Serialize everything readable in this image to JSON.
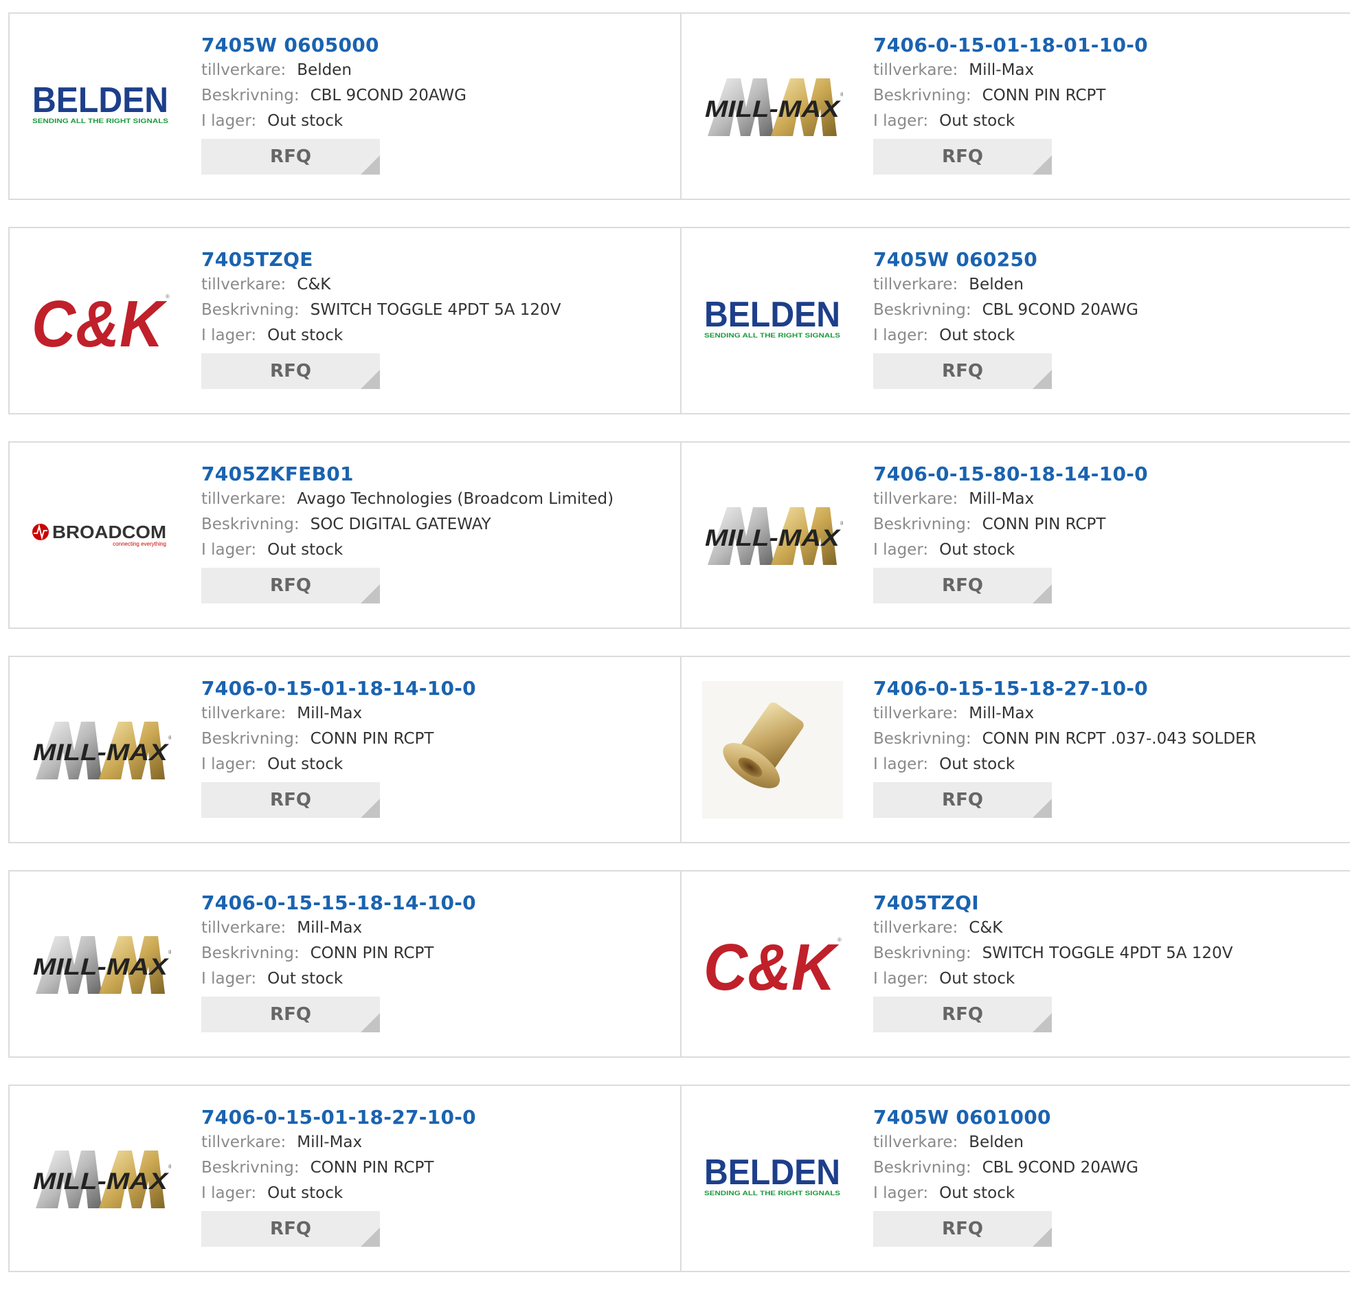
{
  "labels": {
    "manufacturer": "tillverkare:",
    "description": "Beskrivning:",
    "stock": "I lager:",
    "rfq": "RFQ"
  },
  "brand_logos": {
    "belden": {
      "name": "BELDEN",
      "tagline": "SENDING ALL THE RIGHT SIGNALS",
      "color": "#1d3f8a",
      "tagline_color": "#1a9a3c"
    },
    "millmax": {
      "name": "MILL-MAX",
      "color": "#222222",
      "gold": "#c9a44a",
      "silver": "#b5b5b5"
    },
    "ck": {
      "name": "C&K",
      "color": "#c0202a"
    },
    "broadcom": {
      "name": "BROADCOM",
      "tagline": "connecting everything",
      "color": "#cc0000"
    }
  },
  "colors": {
    "link": "#1a63b0",
    "label": "#8a8a8a",
    "button_bg": "#ececec",
    "border": "#dcdcdc"
  },
  "rows": [
    [
      {
        "part": "7405W 0605000",
        "manufacturer": "Belden",
        "description": "CBL 9COND 20AWG",
        "stock": "Out stock",
        "logo": "belden"
      },
      {
        "part": "7406-0-15-01-18-01-10-0",
        "manufacturer": "Mill-Max",
        "description": "CONN PIN RCPT",
        "stock": "Out stock",
        "logo": "millmax"
      }
    ],
    [
      {
        "part": "7405TZQE",
        "manufacturer": "C&K",
        "description": "SWITCH TOGGLE 4PDT 5A 120V",
        "stock": "Out stock",
        "logo": "ck"
      },
      {
        "part": "7405W 060250",
        "manufacturer": "Belden",
        "description": "CBL 9COND 20AWG",
        "stock": "Out stock",
        "logo": "belden"
      }
    ],
    [
      {
        "part": "7405ZKFEB01",
        "manufacturer": "Avago Technologies (Broadcom Limited)",
        "description": "SOC DIGITAL GATEWAY",
        "stock": "Out stock",
        "logo": "broadcom"
      },
      {
        "part": "7406-0-15-80-18-14-10-0",
        "manufacturer": "Mill-Max",
        "description": "CONN PIN RCPT",
        "stock": "Out stock",
        "logo": "millmax"
      }
    ],
    [
      {
        "part": "7406-0-15-01-18-14-10-0",
        "manufacturer": "Mill-Max",
        "description": "CONN PIN RCPT",
        "stock": "Out stock",
        "logo": "millmax"
      },
      {
        "part": "7406-0-15-15-18-27-10-0",
        "manufacturer": "Mill-Max",
        "description": "CONN PIN RCPT .037-.043 SOLDER",
        "stock": "Out stock",
        "logo": "pin-photo"
      }
    ],
    [
      {
        "part": "7406-0-15-15-18-14-10-0",
        "manufacturer": "Mill-Max",
        "description": "CONN PIN RCPT",
        "stock": "Out stock",
        "logo": "millmax"
      },
      {
        "part": "7405TZQI",
        "manufacturer": "C&K",
        "description": "SWITCH TOGGLE 4PDT 5A 120V",
        "stock": "Out stock",
        "logo": "ck"
      }
    ],
    [
      {
        "part": "7406-0-15-01-18-27-10-0",
        "manufacturer": "Mill-Max",
        "description": "CONN PIN RCPT",
        "stock": "Out stock",
        "logo": "millmax"
      },
      {
        "part": "7405W 0601000",
        "manufacturer": "Belden",
        "description": "CBL 9COND 20AWG",
        "stock": "Out stock",
        "logo": "belden"
      }
    ]
  ]
}
